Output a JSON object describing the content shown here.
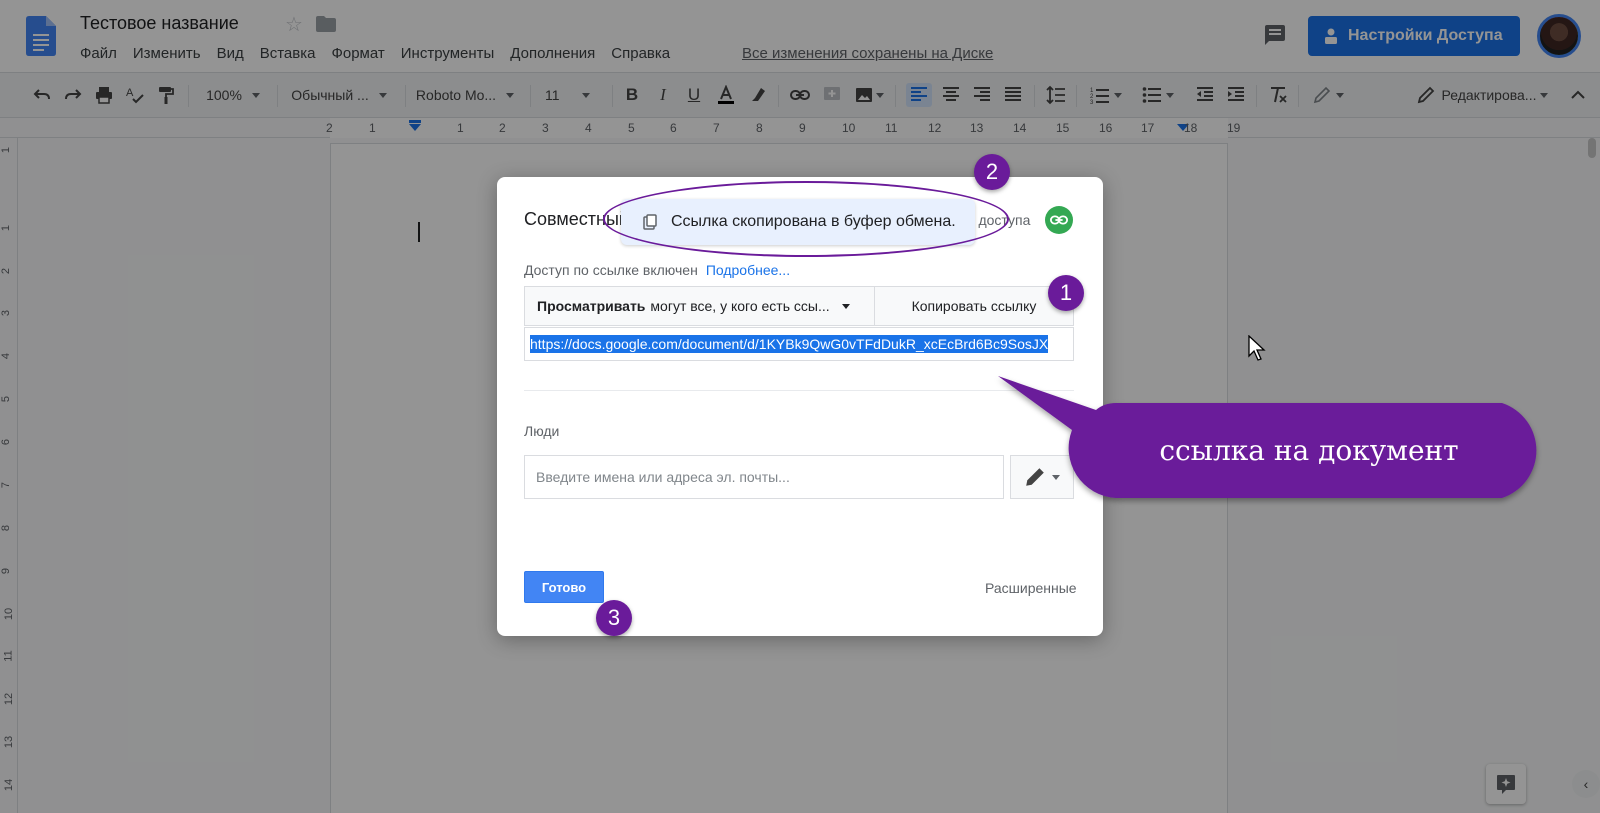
{
  "header": {
    "doc_title": "Тестовое название",
    "menu": [
      "Файл",
      "Изменить",
      "Вид",
      "Вставка",
      "Формат",
      "Инструменты",
      "Дополнения",
      "Справка"
    ],
    "saved_status": "Все изменения сохранены на Диске",
    "share_button": "Настройки Доступа"
  },
  "toolbar": {
    "zoom": "100%",
    "style": "Обычный ...",
    "font": "Roboto Mo...",
    "font_size": "11",
    "mode": "Редактирова..."
  },
  "ruler": {
    "numbers": [
      "2",
      "1",
      "1",
      "2",
      "3",
      "4",
      "5",
      "6",
      "7",
      "8",
      "9",
      "10",
      "11",
      "12",
      "13",
      "14",
      "15",
      "16",
      "17",
      "18",
      "19"
    ],
    "vertical_numbers": [
      "1",
      "1",
      "2",
      "3",
      "4",
      "5",
      "6",
      "7",
      "8",
      "9",
      "10",
      "11",
      "12",
      "13",
      "14"
    ]
  },
  "dialog": {
    "title_left": "Совместный",
    "title_right": "го доступа",
    "access_status": "Доступ по ссылке включен",
    "learn_more": "Подробнее...",
    "permission_bold": "Просматривать",
    "permission_rest": "могут все, у кого есть ссы...",
    "copy_link": "Копировать ссылку",
    "url": "https://docs.google.com/document/d/1KYBk9QwG0vTFdDukR_xcEcBrd6Bc9SosJX",
    "people_label": "Люди",
    "people_placeholder": "Введите имена или адреса эл. почты...",
    "done": "Готово",
    "advanced": "Расширенные"
  },
  "toast": {
    "message": "Ссылка скопирована в буфер обмена."
  },
  "annotations": {
    "badge_1": "1",
    "badge_2": "2",
    "badge_3": "3",
    "callout": "ссылка на документ",
    "accent_color": "#6a1b9a"
  },
  "colors": {
    "share_button": "#1a73e8",
    "done_button": "#4285f4",
    "link_icon_bg": "#34a853"
  }
}
